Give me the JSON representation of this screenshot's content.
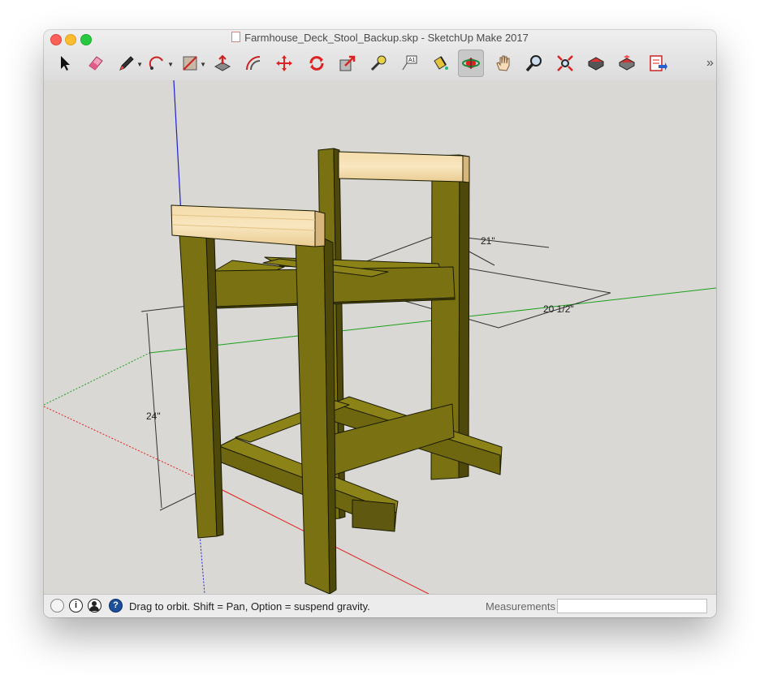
{
  "window": {
    "title": "Farmhouse_Deck_Stool_Backup.skp - SketchUp Make 2017"
  },
  "toolbar": {
    "tools": [
      {
        "name": "select-tool-icon"
      },
      {
        "name": "eraser-tool-icon"
      },
      {
        "name": "pencil-line-tool-icon",
        "dropdown": true
      },
      {
        "name": "arc-tool-icon",
        "dropdown": true
      },
      {
        "name": "rectangle-tool-icon",
        "dropdown": true
      },
      {
        "name": "push-pull-tool-icon"
      },
      {
        "name": "offset-tool-icon"
      },
      {
        "name": "move-tool-icon"
      },
      {
        "name": "rotate-tool-icon"
      },
      {
        "name": "scale-tool-icon"
      },
      {
        "name": "tape-measure-tool-icon"
      },
      {
        "name": "text-tool-icon"
      },
      {
        "name": "paint-bucket-tool-icon"
      },
      {
        "name": "orbit-tool-icon",
        "active": true
      },
      {
        "name": "pan-tool-icon"
      },
      {
        "name": "zoom-tool-icon"
      },
      {
        "name": "zoom-extents-tool-icon"
      },
      {
        "name": "3d-warehouse-icon"
      },
      {
        "name": "extension-warehouse-icon"
      },
      {
        "name": "send-to-layout-icon"
      }
    ],
    "overflow": "»"
  },
  "model": {
    "dimensions": {
      "depth": "21\"",
      "width": "20 1/2\"",
      "height": "24\""
    },
    "colors": {
      "lumber": "#7a7212",
      "seat_wood": "#f1d7a3",
      "background": "#d9d8d4",
      "axis_red": "#e02020",
      "axis_green": "#1aa01a",
      "axis_blue": "#2020d0"
    }
  },
  "statusbar": {
    "hint": "Drag to orbit. Shift = Pan, Option = suspend gravity.",
    "measurements_label": "Measurements",
    "measurements_value": ""
  }
}
